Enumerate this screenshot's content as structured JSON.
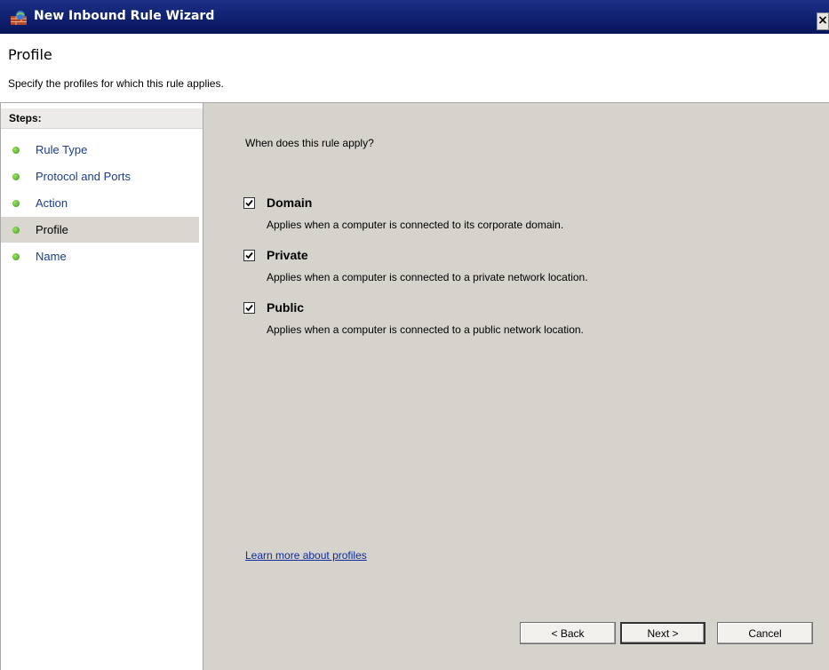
{
  "window": {
    "title": "New Inbound Rule Wizard",
    "close_glyph": "×",
    "icon": "firewall-icon"
  },
  "header": {
    "title": "Profile",
    "subtitle": "Specify the profiles for which this rule applies."
  },
  "steps": {
    "heading": "Steps:",
    "items": [
      {
        "label": "Rule Type"
      },
      {
        "label": "Protocol and Ports"
      },
      {
        "label": "Action"
      },
      {
        "label": "Profile"
      },
      {
        "label": "Name"
      }
    ],
    "active": "Profile"
  },
  "main": {
    "question": "When does this rule apply?",
    "options": [
      {
        "name": "Domain",
        "checked": true,
        "desc": "Applies when a computer is connected to its corporate domain."
      },
      {
        "name": "Private",
        "checked": true,
        "desc": "Applies when a computer is connected to a private network location."
      },
      {
        "name": "Public",
        "checked": true,
        "desc": "Applies when a computer is connected to a public network location."
      }
    ],
    "learn_more": "Learn more about profiles"
  },
  "buttons": {
    "back": "< Back",
    "next": "Next >",
    "cancel": "Cancel"
  },
  "colors": {
    "titlebar": "#0a1e6e",
    "content_bg": "#d6d3cd",
    "link": "#0a2c9c",
    "step_active": "#dad7d1"
  }
}
